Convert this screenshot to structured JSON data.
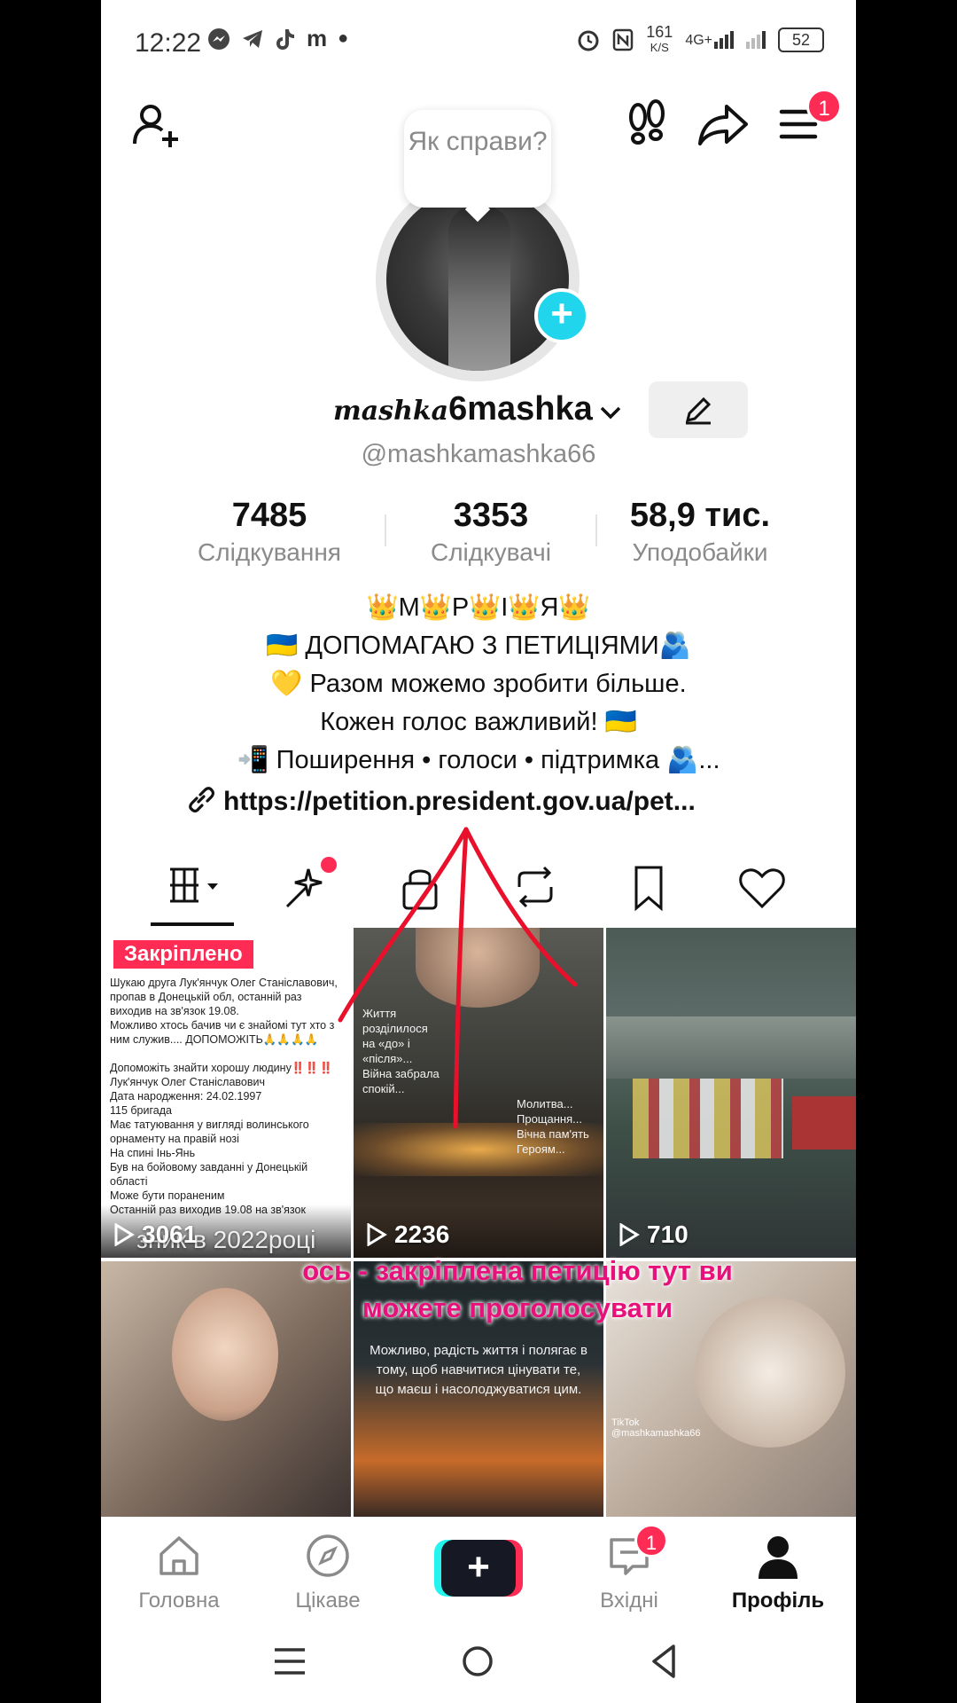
{
  "status": {
    "time": "12:22",
    "app_m": "m",
    "speed_top": "161",
    "speed_bottom": "K/S",
    "network": "4G+",
    "battery": "52"
  },
  "topbar": {
    "add_friend_icon": "add-user-icon",
    "notif_count": "1"
  },
  "profile": {
    "bubble_text": "Як справи?",
    "name_script": "mashka",
    "name_rest": "6mashka",
    "handle": "@mashkamashka66"
  },
  "stats": [
    {
      "num": "7485",
      "label": "Слідкування"
    },
    {
      "num": "3353",
      "label": "Слідкувачі"
    },
    {
      "num": "58,9 тис.",
      "label": "Уподобайки"
    }
  ],
  "bio": {
    "line1": "👑М👑Р👑І👑Я👑",
    "line2": "🇺🇦 ДОПОМАГАЮ З ПЕТИЦІЯМИ🫂",
    "line3": "💛 Разом можемо зробити більше.",
    "line4": "Кожен голос важливий! 🇺🇦",
    "line5": "📲 Поширення • голоси • підтримка 🫂...",
    "link": "https://petition.president.gov.ua/pet..."
  },
  "grid": {
    "pinned_label": "Закріплено",
    "tile1_text": "Шукаю друга Лук'янчук Олег Станіславович, пропав в Донецькій обл, останній раз виходив на зв'язок 19.08.\nМожливо хтось бачив чи є знайомі тут хто з ним служив.... ДОПОМОЖІТЬ🙏🙏🙏🙏\n\nДопоможіть знайти хорошу людину‼️‼️‼️\nЛук'янчук Олег Станіславович\nДата народження: 24.02.1997\n115 бригада\nМає татуювання у вигляді волинського орнаменту на правій нозі\nНа спині Інь-Янь\nБув на бойовому завданні у Донецькій області\nМоже бути пораненим\nОстанній раз виходив 19.08 на зв'язок",
    "tile1_overlay": "зник в 2022році",
    "tile1_views": "3061",
    "tile2_views": "2236",
    "tile2_caption_a": "Життя розділилося на «до» і «після»... Війна забрала спокій...",
    "tile2_caption_b": "Молитва... Прощання... Вічна пам'ять Героям...",
    "tile3_views": "710",
    "tile5_quote": "Можливо, радість життя і полягає в тому, щоб навчитися цінувати те, що маєш і насолоджуватися цим.",
    "tile6_mark": "TikTok\n@mashkamashka66"
  },
  "annotation": "ось - закріплена петицію тут ви можете проголосувати",
  "nav": {
    "home": "Головна",
    "discover": "Цікаве",
    "inbox": "Вхідні",
    "inbox_badge": "1",
    "profile": "Профіль"
  },
  "colors": {
    "accent": "#fe2c55",
    "cyan": "#25f4ee",
    "annotation": "#e8107a"
  }
}
